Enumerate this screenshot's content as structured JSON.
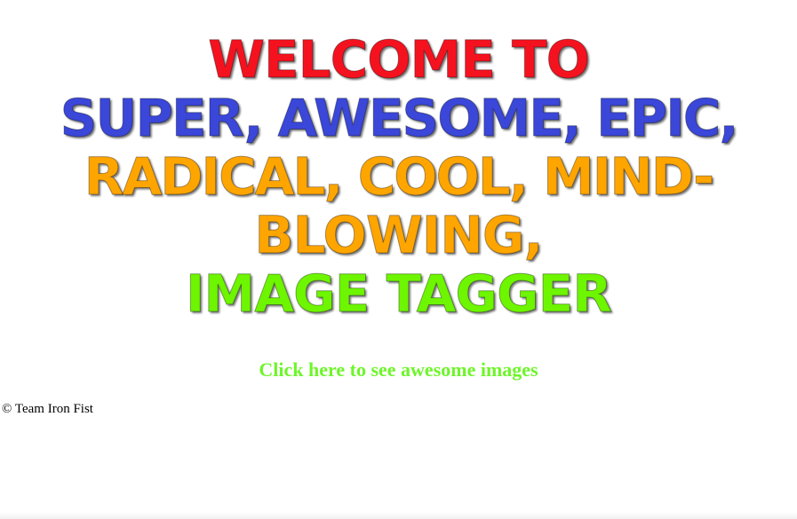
{
  "hero": {
    "line1": "Welcome to",
    "line2": "Super, Awesome, Epic,",
    "line3": "Radical, Cool, Mind-",
    "line4": "Blowing,",
    "line5": "Image Tagger"
  },
  "cta": {
    "label": "Click here to see awesome images"
  },
  "footer": {
    "copyright": "© Team Iron Fist"
  },
  "colors": {
    "red": "#f5121f",
    "blue": "#3a47d9",
    "orange": "#ffa500",
    "green": "#6ef500",
    "link": "#6ef52a"
  }
}
